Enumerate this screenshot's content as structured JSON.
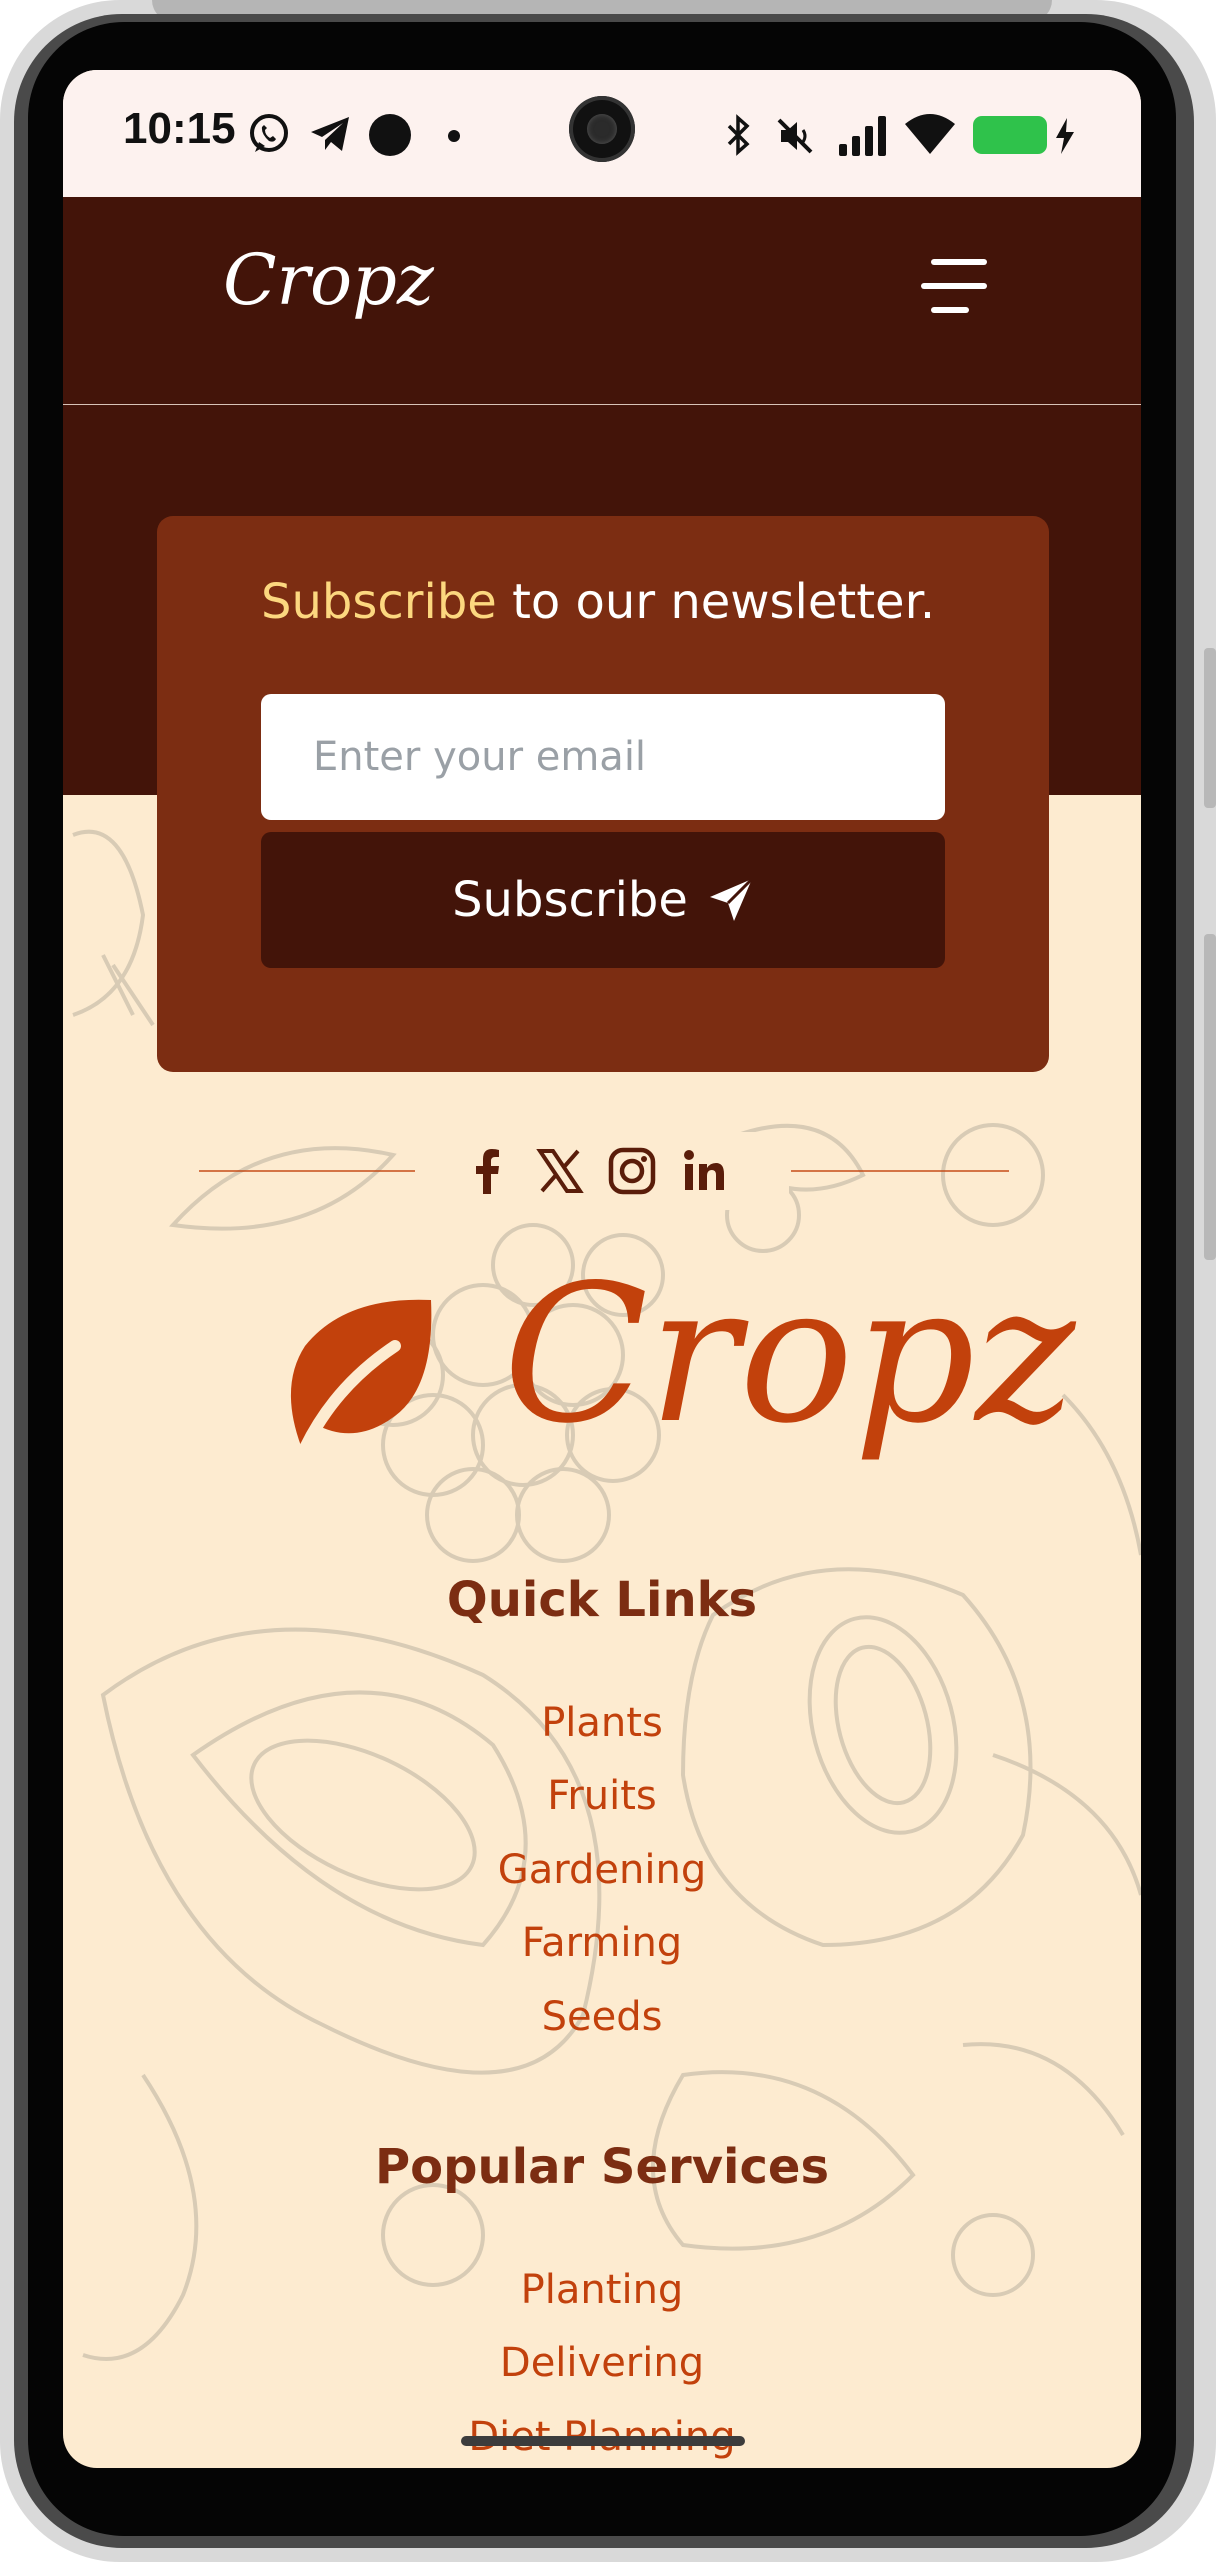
{
  "status_bar": {
    "time": "10:15"
  },
  "header": {
    "brand": "Cropz"
  },
  "newsletter": {
    "title_highlight": "Subscribe",
    "title_rest": " to our newsletter.",
    "email_placeholder": "Enter your email",
    "button_label": "Subscribe"
  },
  "footer": {
    "logo_text": "Cropz",
    "quick_links": {
      "title": "Quick Links",
      "items": [
        "Plants",
        "Fruits",
        "Gardening",
        "Farming",
        "Seeds"
      ]
    },
    "popular_services": {
      "title": "Popular Services",
      "items": [
        "Planting",
        "Delivering",
        "Diet Planning"
      ]
    }
  },
  "colors": {
    "header_bg": "#431409",
    "card_bg": "#7c2d12",
    "accent": "#c2410c",
    "highlight": "#fcd77f",
    "page_bg": "#fdebd0"
  }
}
